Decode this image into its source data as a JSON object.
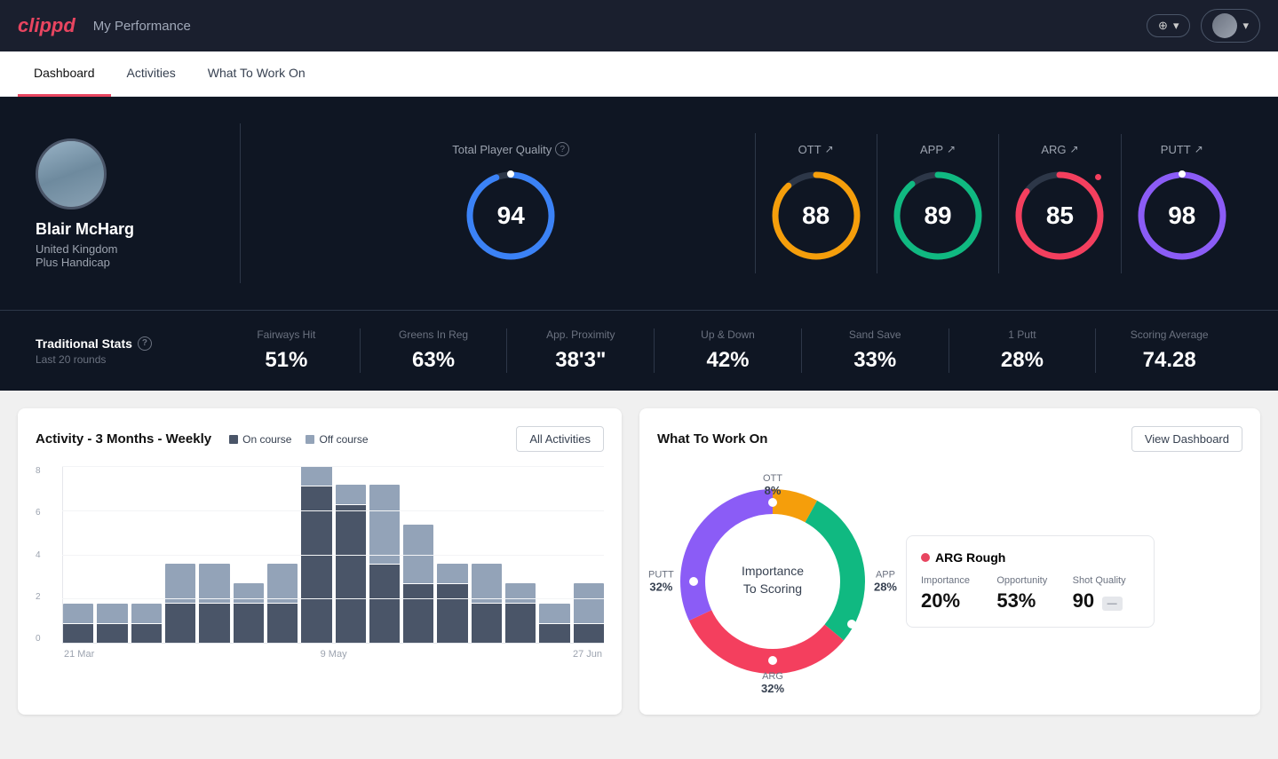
{
  "header": {
    "logo": "clippd",
    "title": "My Performance",
    "add_button": "+",
    "user_dropdown": "▾"
  },
  "tabs": [
    {
      "label": "Dashboard",
      "active": true
    },
    {
      "label": "Activities",
      "active": false
    },
    {
      "label": "What To Work On",
      "active": false
    }
  ],
  "player": {
    "name": "Blair McHarg",
    "country": "United Kingdom",
    "handicap": "Plus Handicap"
  },
  "total_quality": {
    "label": "Total Player Quality",
    "value": 94,
    "color": "#3b82f6",
    "percent": 94
  },
  "score_panels": [
    {
      "label": "OTT",
      "value": 88,
      "color": "#f59e0b",
      "percent": 88,
      "trend": "↗"
    },
    {
      "label": "APP",
      "value": 89,
      "color": "#10b981",
      "percent": 89,
      "trend": "↗"
    },
    {
      "label": "ARG",
      "value": 85,
      "color": "#f43f5e",
      "percent": 85,
      "trend": "↗"
    },
    {
      "label": "PUTT",
      "value": 98,
      "color": "#8b5cf6",
      "percent": 98,
      "trend": "↗"
    }
  ],
  "traditional_stats": {
    "label": "Traditional Stats",
    "sub": "Last 20 rounds",
    "stats": [
      {
        "label": "Fairways Hit",
        "value": "51%"
      },
      {
        "label": "Greens In Reg",
        "value": "63%"
      },
      {
        "label": "App. Proximity",
        "value": "38'3\""
      },
      {
        "label": "Up & Down",
        "value": "42%"
      },
      {
        "label": "Sand Save",
        "value": "33%"
      },
      {
        "label": "1 Putt",
        "value": "28%"
      },
      {
        "label": "Scoring Average",
        "value": "74.28"
      }
    ]
  },
  "activity_chart": {
    "title": "Activity - 3 Months - Weekly",
    "legend": {
      "on_course": "On course",
      "off_course": "Off course"
    },
    "button": "All Activities",
    "x_labels": [
      "21 Mar",
      "9 May",
      "27 Jun"
    ],
    "bars": [
      {
        "on": 1,
        "off": 1
      },
      {
        "on": 1,
        "off": 1
      },
      {
        "on": 1,
        "off": 1
      },
      {
        "on": 2,
        "off": 2
      },
      {
        "on": 2,
        "off": 2
      },
      {
        "on": 2,
        "off": 1
      },
      {
        "on": 2,
        "off": 2
      },
      {
        "on": 8,
        "off": 1
      },
      {
        "on": 7,
        "off": 1
      },
      {
        "on": 4,
        "off": 4
      },
      {
        "on": 3,
        "off": 3
      },
      {
        "on": 3,
        "off": 1
      },
      {
        "on": 2,
        "off": 2
      },
      {
        "on": 2,
        "off": 1
      },
      {
        "on": 1,
        "off": 1
      },
      {
        "on": 1,
        "off": 2
      }
    ],
    "y_labels": [
      "8",
      "6",
      "4",
      "2",
      "0"
    ]
  },
  "what_to_work_on": {
    "title": "What To Work On",
    "button": "View Dashboard",
    "donut": {
      "center_text1": "Importance",
      "center_text2": "To Scoring",
      "segments": [
        {
          "label": "OTT",
          "value": "8%",
          "color": "#f59e0b"
        },
        {
          "label": "APP",
          "value": "28%",
          "color": "#10b981"
        },
        {
          "label": "ARG",
          "value": "32%",
          "color": "#f43f5e"
        },
        {
          "label": "PUTT",
          "value": "32%",
          "color": "#8b5cf6"
        }
      ]
    },
    "detail_card": {
      "title": "ARG Rough",
      "color": "#e84560",
      "importance_label": "Importance",
      "importance_value": "20%",
      "opportunity_label": "Opportunity",
      "opportunity_value": "53%",
      "shot_quality_label": "Shot Quality",
      "shot_quality_value": "90"
    }
  }
}
